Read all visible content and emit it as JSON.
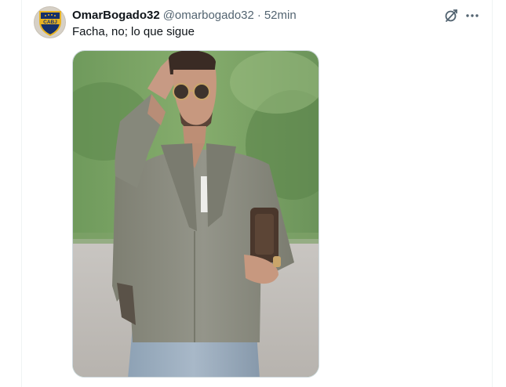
{
  "tweet": {
    "author": {
      "display_name": "OmarBogado32",
      "handle": "@omarbogado32",
      "separator": "·",
      "time": "52min",
      "avatar_badge": "CABJ"
    },
    "text": "Facha, no; lo que sigue",
    "actions": {
      "grok_icon": "grok-icon",
      "more_icon": "more-icon"
    },
    "media": {
      "type": "photo",
      "alt": "photo"
    }
  },
  "colors": {
    "primary_text": "#0f1419",
    "secondary_text": "#536471",
    "border": "#cfd9de",
    "badge_blue": "#14306b",
    "badge_gold": "#e8b321"
  }
}
